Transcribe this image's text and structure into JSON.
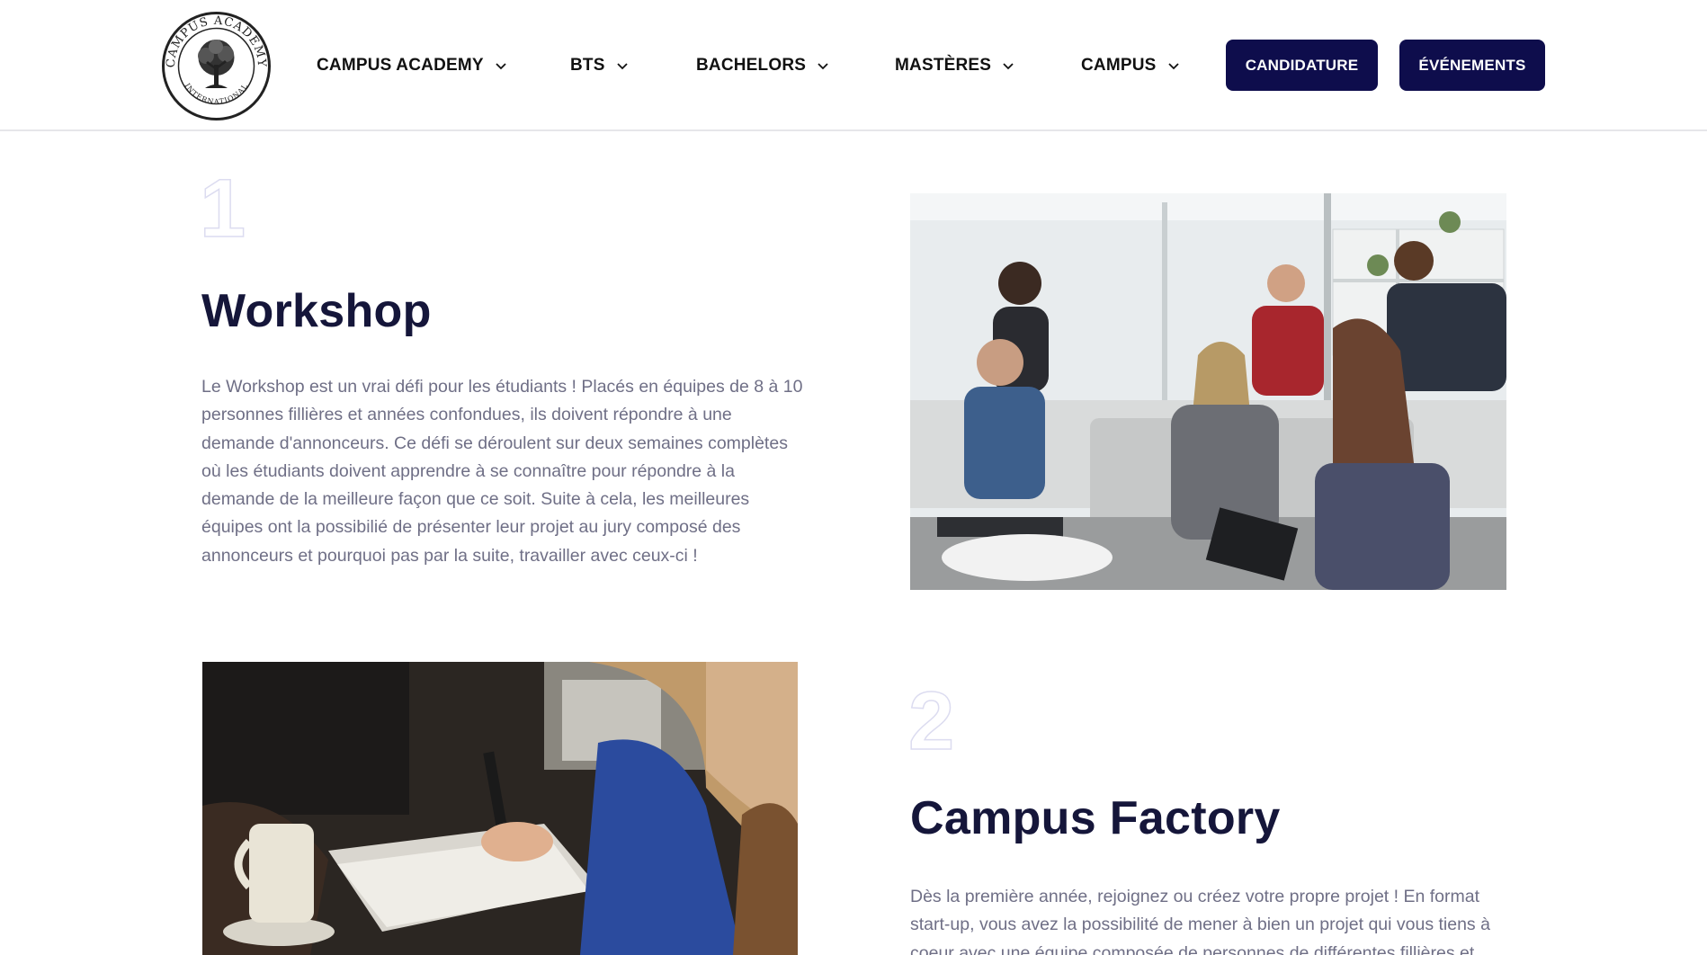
{
  "header": {
    "logo": {
      "top_text": "CAMPUS ACADEMY",
      "bottom_text": "INTERNATIONAL"
    },
    "nav": [
      {
        "label": "CAMPUS ACADEMY",
        "icon": "chevron-down-icon"
      },
      {
        "label": "BTS",
        "icon": "chevron-down-icon"
      },
      {
        "label": "BACHELORS",
        "icon": "chevron-down-icon"
      },
      {
        "label": "MASTÈRES",
        "icon": "chevron-down-icon"
      },
      {
        "label": "CAMPUS",
        "icon": "chevron-down-icon"
      }
    ],
    "buttons": {
      "candidature": "CANDIDATURE",
      "evenements": "ÉVÉNEMENTS"
    }
  },
  "sections": [
    {
      "number": "1",
      "title": "Workshop",
      "text": "Le Workshop est un vrai défi pour les étudiants ! Placés en équipes de 8 à 10 personnes fillières et années confondues, ils doivent répondre à une demande d'annonceurs. Ce défi se déroulent sur deux semaines complètes où les étudiants doivent apprendre à se connaître pour répondre à la demande de la meilleure façon que ce soit. Suite à cela, les meilleures équipes ont la possibilié de présenter leur projet au jury composé des annonceurs et pourquoi pas par la suite, travailler avec ceux-ci !"
    },
    {
      "number": "2",
      "title": "Campus Factory",
      "text": "Dès la première année, rejoignez ou créez votre propre projet ! En format start-up, vous avez la possibilité de mener à bien un projet qui vous tiens à coeur avec une équipe composée de personnes de différentes fillières et"
    }
  ],
  "colors": {
    "primary": "#0e0d4c",
    "heading": "#15163a",
    "body_text": "#6f6f86",
    "number_outline": "#dcdcf0"
  }
}
